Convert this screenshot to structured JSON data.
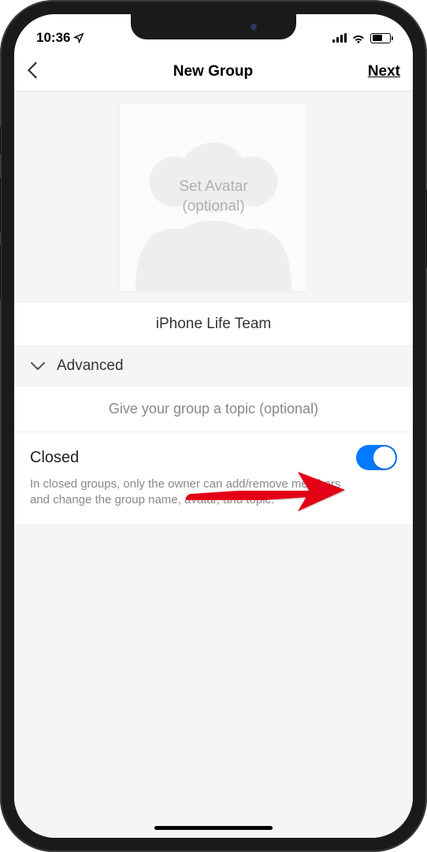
{
  "status": {
    "time": "10:36"
  },
  "nav": {
    "title": "New Group",
    "next": "Next"
  },
  "avatar": {
    "line1": "Set Avatar",
    "line2": "(optional)"
  },
  "group_name": "iPhone Life Team",
  "advanced": {
    "label": "Advanced"
  },
  "topic": {
    "placeholder": "Give your group a topic (optional)"
  },
  "closed": {
    "label": "Closed",
    "description": "In closed groups, only the owner can add/remove members and change the group name, avatar, and topic.",
    "enabled": true
  }
}
